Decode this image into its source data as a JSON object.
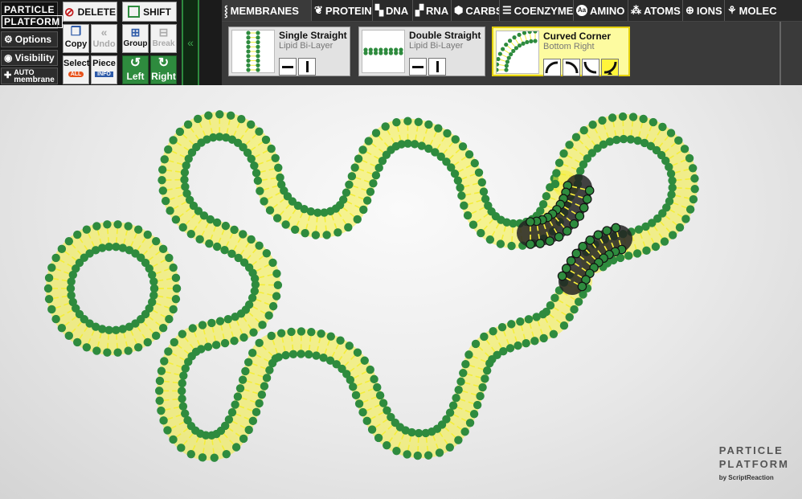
{
  "app": {
    "logo_line1": "PARTICLE",
    "logo_line2": "PLATFORM"
  },
  "left_menu": {
    "options_label": "Options",
    "visibility_label": "Visibility",
    "auto_line1": "AUTO",
    "auto_line2": "membrane"
  },
  "tools": {
    "delete_label": "DELETE",
    "shift_label": "SHIFT",
    "copy_label": "Copy",
    "undo_label": "Undo",
    "group_label": "Group",
    "break_label": "Break",
    "select_label": "Select",
    "select_badge": "ALL",
    "piece_label": "Piece",
    "piece_badge": "INFO",
    "left_label": "Left",
    "right_label": "Right"
  },
  "tabs": [
    {
      "label": "MEMBRANES",
      "icon": "membrane-icon"
    },
    {
      "label": "PROTEINS",
      "icon": "protein-icon"
    },
    {
      "label": "DNA",
      "icon": "dna-icon"
    },
    {
      "label": "RNA",
      "icon": "rna-icon"
    },
    {
      "label": "CARBS",
      "icon": "carbs-icon"
    },
    {
      "label": "COENZYME",
      "icon": "coenzyme-icon"
    },
    {
      "label": "AMINO",
      "icon": "amino-icon"
    },
    {
      "label": "ATOMS",
      "icon": "atom-icon"
    },
    {
      "label": "IONS",
      "icon": "ion-icon"
    },
    {
      "label": "MOLEC",
      "icon": "molecule-icon"
    }
  ],
  "pieces": [
    {
      "title": "Single Straight",
      "subtitle": "Lipid Bi-Layer"
    },
    {
      "title": "Double Straight",
      "subtitle": "Lipid Bi-Layer"
    },
    {
      "title": "Curved Corner",
      "subtitle": "Bottom Right"
    }
  ],
  "watermark": {
    "line1": "PARTICLE",
    "line2": "PLATFORM",
    "by": "by ScriptReaction"
  },
  "colors": {
    "head_green": "#2e8b3e",
    "tail_yellow": "#f4ee3a",
    "accent_green": "#2e8b3e",
    "selected_card": "#fdfba0"
  }
}
